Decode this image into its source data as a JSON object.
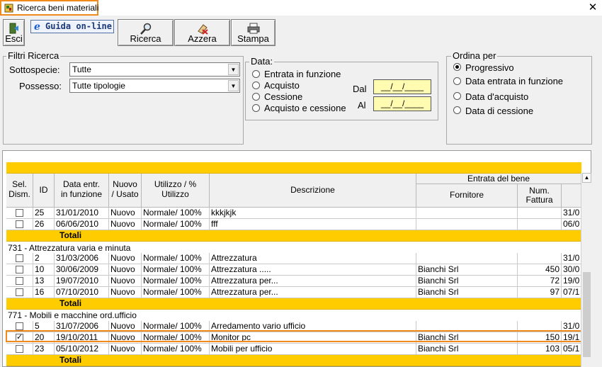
{
  "window": {
    "title": "Ricerca beni materiali",
    "close_glyph": "✕"
  },
  "toolbar": {
    "esci": "Esci",
    "guida": "Guida on-line",
    "guida_icon": "e",
    "ricerca": "Ricerca",
    "azzera": "Azzera",
    "stampa": "Stampa"
  },
  "filtri": {
    "legend": "Filtri Ricerca",
    "sottospecie_label": "Sottospecie:",
    "sottospecie_value": "Tutte",
    "possesso_label": "Possesso:",
    "possesso_value": "Tutte tipologie"
  },
  "data_group": {
    "legend": "Data:",
    "options": [
      "Entrata in funzione",
      "Acquisto",
      "Cessione",
      "Acquisto e cessione"
    ],
    "dal_label": "Dal",
    "al_label": "Al",
    "dal_value": "__/__/____",
    "al_value": "__/__/____"
  },
  "ordina": {
    "legend": "Ordina per",
    "options": [
      "Progressivo",
      "Data entrata in funzione",
      "Data d'acquisto",
      "Data di cessione"
    ],
    "selected": 0
  },
  "grid": {
    "headers": {
      "sel": "Sel.\nDism.",
      "id": "ID",
      "data": "Data entr.\nin funzione",
      "nuovo": "Nuovo\n/ Usato",
      "utilizzo": "Utilizzo / %\nUtilizzo",
      "descrizione": "Descrizione",
      "entrata": "Entrata del bene",
      "fornitore": "Fornitore",
      "fattura": "Num.\nFattura"
    },
    "group1_rows": [
      {
        "checked": false,
        "id": "25",
        "data": "31/01/2010",
        "nuovo": "Nuovo",
        "utilizzo": "Normale/ 100%",
        "descr": "kkkjkjk",
        "fornitore": "",
        "fattura": "",
        "extra": "31/0"
      },
      {
        "checked": false,
        "id": "26",
        "data": "06/06/2010",
        "nuovo": "Nuovo",
        "utilizzo": "Normale/ 100%",
        "descr": "fff",
        "fornitore": "",
        "fattura": "",
        "extra": "06/0"
      }
    ],
    "totali": "Totali",
    "group2_label": "731 - Attrezzatura varia e minuta",
    "group2_rows": [
      {
        "checked": false,
        "id": "2",
        "data": "31/03/2006",
        "nuovo": "Nuovo",
        "utilizzo": "Normale/ 100%",
        "descr": "Attrezzatura",
        "fornitore": "",
        "fattura": "",
        "extra": "31/0"
      },
      {
        "checked": false,
        "id": "10",
        "data": "30/06/2009",
        "nuovo": "Nuovo",
        "utilizzo": "Normale/ 100%",
        "descr": "Attrezzatura .....",
        "fornitore": "Bianchi Srl",
        "fattura": "450",
        "extra": "30/0"
      },
      {
        "checked": false,
        "id": "13",
        "data": "19/07/2010",
        "nuovo": "Nuovo",
        "utilizzo": "Normale/ 100%",
        "descr": "Attrezzatura per...",
        "fornitore": "Bianchi Srl",
        "fattura": "72",
        "extra": "19/0"
      },
      {
        "checked": false,
        "id": "16",
        "data": "07/10/2010",
        "nuovo": "Nuovo",
        "utilizzo": "Normale/ 100%",
        "descr": "Attrezzatura per...",
        "fornitore": "Bianchi Srl",
        "fattura": "97",
        "extra": "07/1"
      }
    ],
    "group3_label": "771 - Mobili e macchine ord.ufficio",
    "group3_rows": [
      {
        "checked": false,
        "id": "5",
        "data": "31/07/2006",
        "nuovo": "Nuovo",
        "utilizzo": "Normale/ 100%",
        "descr": "Arredamento vario ufficio",
        "fornitore": "",
        "fattura": "",
        "extra": "31/0"
      },
      {
        "checked": true,
        "id": "20",
        "data": "19/10/2011",
        "nuovo": "Nuovo",
        "utilizzo": "Normale/ 100%",
        "descr": "Monitor pc",
        "fornitore": "Bianchi Srl",
        "fattura": "150",
        "extra": "19/1"
      },
      {
        "checked": false,
        "id": "23",
        "data": "05/10/2012",
        "nuovo": "Nuovo",
        "utilizzo": "Normale/ 100%",
        "descr": "Mobili per ufficio",
        "fornitore": "Bianchi Srl",
        "fattura": "103",
        "extra": "05/1"
      }
    ]
  },
  "colors": {
    "highlight": "#f08a1c",
    "totals": "#ffcc00",
    "datebox": "#fffbb0"
  }
}
